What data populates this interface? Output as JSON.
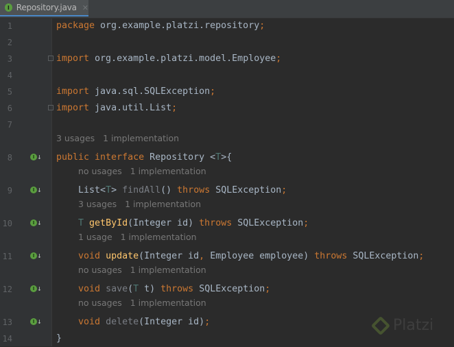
{
  "tab": {
    "icon": "interface-icon",
    "icon_letter": "I",
    "label": "Repository.java",
    "close": "✕"
  },
  "watermark": {
    "text": "Platzi"
  },
  "rows": [
    {
      "n": "1",
      "tokens": [
        [
          "kw",
          "package "
        ],
        [
          "pl",
          "org.example.platzi.repository"
        ],
        [
          "sc",
          ";"
        ]
      ]
    },
    {
      "n": "2",
      "tokens": []
    },
    {
      "n": "3",
      "fold": true,
      "tokens": [
        [
          "kw",
          "import "
        ],
        [
          "pl",
          "org.example.platzi.model.Employee"
        ],
        [
          "sc",
          ";"
        ]
      ]
    },
    {
      "n": "4",
      "tokens": []
    },
    {
      "n": "5",
      "tokens": [
        [
          "kw",
          "import "
        ],
        [
          "pl",
          "java.sql.SQLException"
        ],
        [
          "sc",
          ";"
        ]
      ]
    },
    {
      "n": "6",
      "fold": true,
      "tokens": [
        [
          "kw",
          "import "
        ],
        [
          "pl",
          "java.util.List"
        ],
        [
          "sc",
          ";"
        ]
      ]
    },
    {
      "n": "7",
      "tokens": []
    },
    {
      "hint": "3 usages   1 implementation",
      "indent": 0
    },
    {
      "n": "8",
      "impl": true,
      "tokens": [
        [
          "kw",
          "public interface "
        ],
        [
          "pl",
          "Repository <"
        ],
        [
          "tp",
          "T"
        ],
        [
          "pl",
          ">{"
        ]
      ]
    },
    {
      "hint": "no usages   1 implementation",
      "indent": 1
    },
    {
      "n": "9",
      "impl": true,
      "tokens": [
        [
          "pl",
          "    List<"
        ],
        [
          "tp",
          "T"
        ],
        [
          "pl",
          "> "
        ],
        [
          "un",
          "findAll"
        ],
        [
          "pl",
          "() "
        ],
        [
          "kw",
          "throws "
        ],
        [
          "pl",
          "SQLException"
        ],
        [
          "sc",
          ";"
        ]
      ]
    },
    {
      "hint": "3 usages   1 implementation",
      "indent": 1
    },
    {
      "n": "10",
      "impl": true,
      "tokens": [
        [
          "pl",
          "    "
        ],
        [
          "tp",
          "T "
        ],
        [
          "fn",
          "getById"
        ],
        [
          "pl",
          "(Integer id) "
        ],
        [
          "kw",
          "throws "
        ],
        [
          "pl",
          "SQLException"
        ],
        [
          "sc",
          ";"
        ]
      ]
    },
    {
      "hint": "1 usage   1 implementation",
      "indent": 1
    },
    {
      "n": "11",
      "impl": true,
      "tokens": [
        [
          "pl",
          "    "
        ],
        [
          "kw",
          "void "
        ],
        [
          "fn",
          "update"
        ],
        [
          "pl",
          "(Integer id"
        ],
        [
          "sc",
          ", "
        ],
        [
          "pl",
          "Employee employee) "
        ],
        [
          "kw",
          "throws "
        ],
        [
          "pl",
          "SQLException"
        ],
        [
          "sc",
          ";"
        ]
      ]
    },
    {
      "hint": "no usages   1 implementation",
      "indent": 1
    },
    {
      "n": "12",
      "impl": true,
      "tokens": [
        [
          "pl",
          "    "
        ],
        [
          "kw",
          "void "
        ],
        [
          "un",
          "save"
        ],
        [
          "pl",
          "("
        ],
        [
          "tp",
          "T "
        ],
        [
          "pl",
          "t) "
        ],
        [
          "kw",
          "throws "
        ],
        [
          "pl",
          "SQLException"
        ],
        [
          "sc",
          ";"
        ]
      ]
    },
    {
      "hint": "no usages   1 implementation",
      "indent": 1
    },
    {
      "n": "13",
      "impl": true,
      "tokens": [
        [
          "pl",
          "    "
        ],
        [
          "kw",
          "void "
        ],
        [
          "un",
          "delete"
        ],
        [
          "pl",
          "(Integer id)"
        ],
        [
          "sc",
          ";"
        ]
      ]
    },
    {
      "n": "14",
      "tokens": [
        [
          "pl",
          "}"
        ]
      ]
    }
  ]
}
